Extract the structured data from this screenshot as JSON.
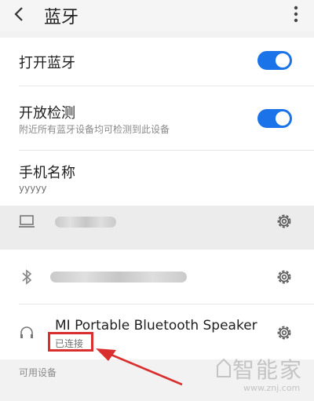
{
  "header": {
    "title": "蓝牙"
  },
  "settings": {
    "open_bluetooth": {
      "label": "打开蓝牙",
      "on": true
    },
    "visibility": {
      "label": "开放检测",
      "sub": "附近所有蓝牙设备均可检测到此设备",
      "on": true
    },
    "phone_name": {
      "label": "手机名称",
      "value": "yyyyy"
    }
  },
  "paired_devices": [
    {
      "icon": "laptop-icon",
      "name_blurred": true
    },
    {
      "icon": "bluetooth-icon",
      "name_blurred": true
    },
    {
      "icon": "headphones-icon",
      "name": "MI Portable Bluetooth Speaker",
      "status": "已连接"
    }
  ],
  "section": {
    "available_devices": "可用设备"
  },
  "watermark": {
    "brand": "智能家",
    "url": "www.znj.com"
  },
  "colors": {
    "toggle_on": "#1a73e8",
    "annotation": "#d9302f"
  }
}
